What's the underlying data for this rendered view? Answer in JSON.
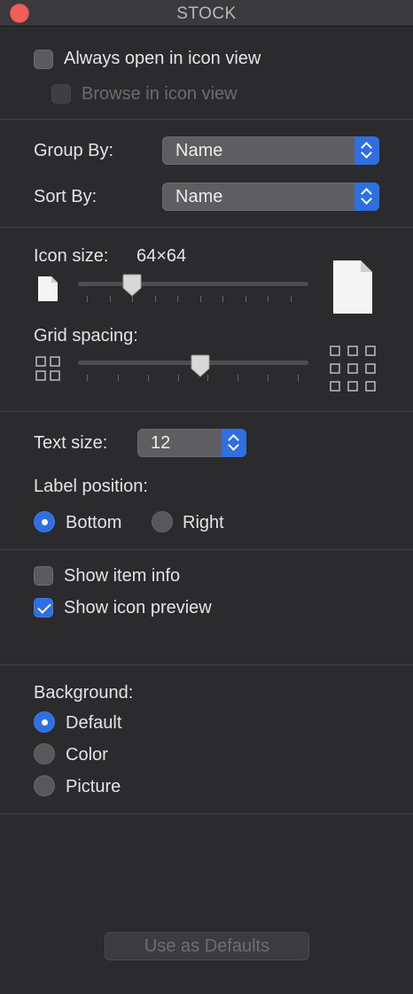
{
  "window": {
    "title": "STOCK"
  },
  "options": {
    "always_open": "Always open in icon view",
    "browse": "Browse in icon view"
  },
  "group_by": {
    "label": "Group By:",
    "value": "Name"
  },
  "sort_by": {
    "label": "Sort By:",
    "value": "Name"
  },
  "icon_size": {
    "label": "Icon size:",
    "value": "64×64"
  },
  "grid_spacing": {
    "label": "Grid spacing:"
  },
  "text_size": {
    "label": "Text size:",
    "value": "12"
  },
  "label_position": {
    "label": "Label position:",
    "bottom": "Bottom",
    "right": "Right",
    "selected": "Bottom"
  },
  "info": {
    "show_item_info": "Show item info",
    "show_icon_preview": "Show icon preview"
  },
  "background": {
    "label": "Background:",
    "default": "Default",
    "color": "Color",
    "picture": "Picture",
    "selected": "Default"
  },
  "footer": {
    "use_defaults": "Use as Defaults"
  },
  "colors": {
    "accent": "#2f6fe0",
    "close": "#ee5f58"
  }
}
